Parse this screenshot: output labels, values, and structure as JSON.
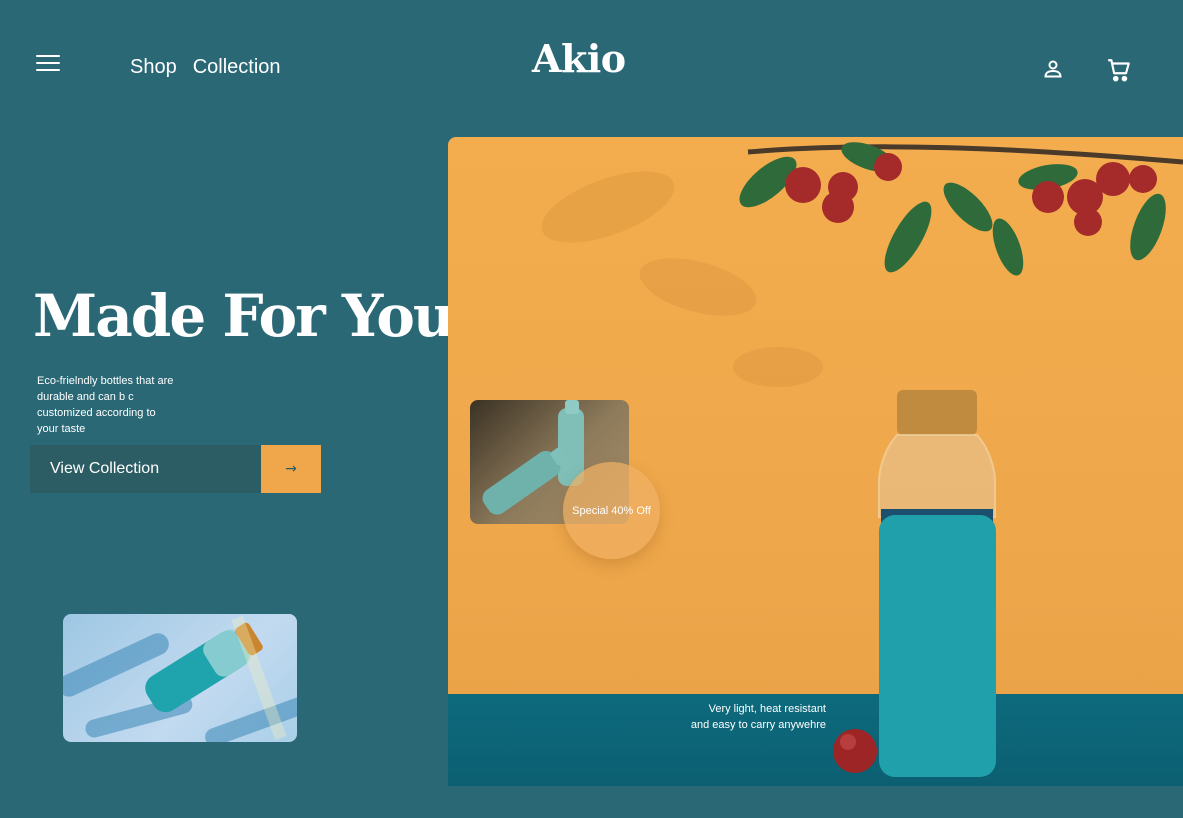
{
  "header": {
    "nav": [
      {
        "label": "Shop"
      },
      {
        "label": "Collection"
      }
    ],
    "logo": "Akio"
  },
  "hero": {
    "title": "Made For You",
    "description": "Eco-frielndly bottles that are durable and can b c customized according to your taste",
    "cta_label": "View Collection",
    "cta_arrow": "→"
  },
  "promo": {
    "badge": "Special 40% Off",
    "caption_line1": "Very light, heat resistant",
    "caption_line2": "and easy to carry anywehre"
  },
  "colors": {
    "background": "#2a6876",
    "accent": "#f0a64a",
    "cta_bg": "#2d5d64",
    "bottle": "#1fa0ab"
  },
  "icons": [
    "menu-icon",
    "user-icon",
    "cart-icon",
    "arrow-right-icon"
  ]
}
